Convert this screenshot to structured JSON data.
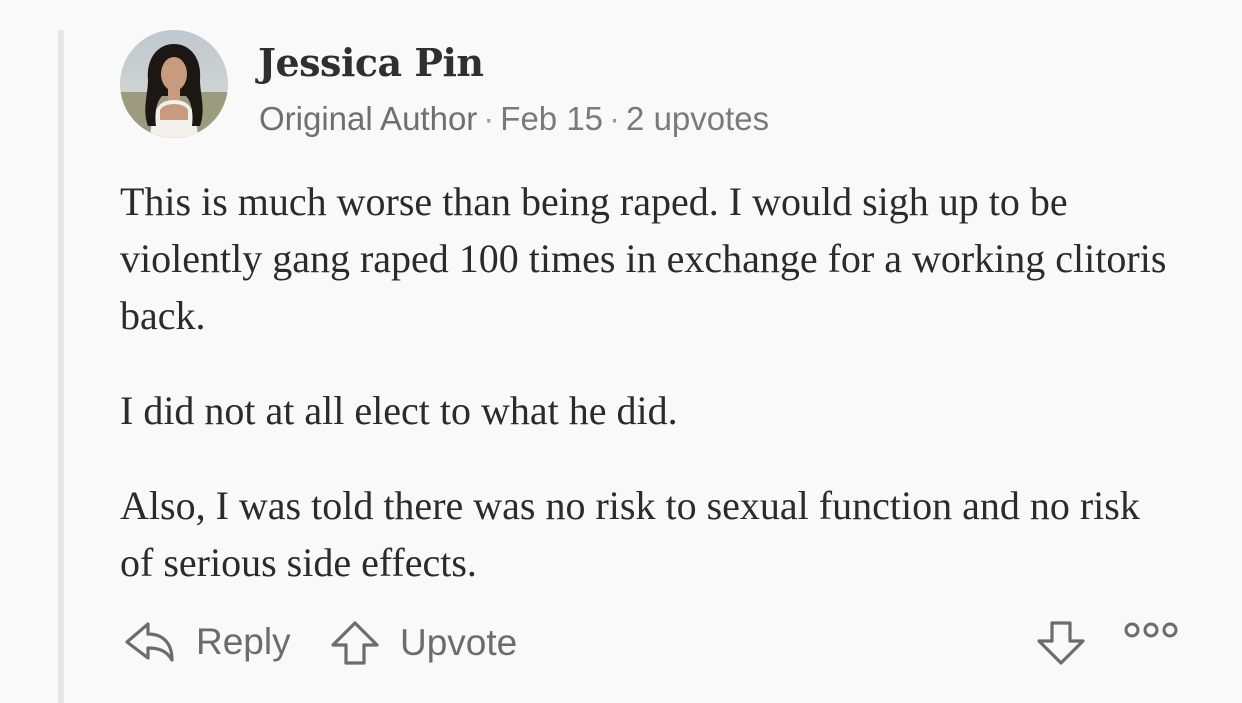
{
  "author": {
    "name": "Jessica Pin",
    "role": "Original Author",
    "date": "Feb 15",
    "upvotes": "2 upvotes",
    "separator": "·"
  },
  "comment": {
    "paragraphs": [
      "This is much worse than being raped. I would sigh up to be violently gang raped 100 times in exchange for a working clitoris back.",
      "I did not at all elect to what he did.",
      "Also, I was told there was no risk to sexual function and no risk of serious side effects."
    ]
  },
  "actions": {
    "reply_label": "Reply",
    "upvote_label": "Upvote",
    "downvote_icon": "arrow-down-icon",
    "more_icon": "more-icon"
  },
  "colors": {
    "background": "#f9f9f9",
    "thread_line": "#e6e6e6",
    "text": "#2b2b2b",
    "muted": "#7a7a7a"
  }
}
